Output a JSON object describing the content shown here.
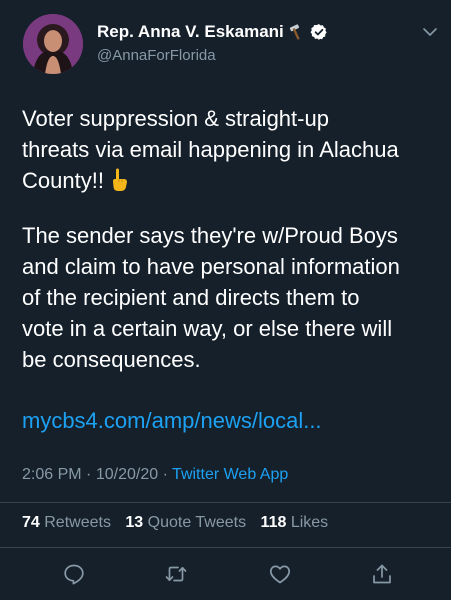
{
  "author": {
    "display_name": "Rep. Anna V. Eskamani",
    "handle": "@AnnaForFlorida",
    "name_emoji_icon": "hammer-icon",
    "verified_icon": "verified-badge-icon"
  },
  "tweet": {
    "paragraph1_line1": "Voter suppression & straight-up",
    "paragraph1_line2": "threats via email happening in Alachua",
    "paragraph1_line3": "County!!",
    "paragraph1_emoji_icon": "pointing-down-hand-icon",
    "paragraph2_line1": "The sender says they're w/Proud Boys",
    "paragraph2_line2": "and claim to have personal information",
    "paragraph2_line3": "of the recipient and directs them to",
    "paragraph2_line4": "vote in a certain way, or else there will",
    "paragraph2_line5": "be consequences.",
    "link_text": "mycbs4.com/amp/news/local..."
  },
  "meta": {
    "time": "2:06 PM",
    "separator": "·",
    "date": "10/20/20",
    "source": "Twitter Web App"
  },
  "stats": {
    "retweets_count": "74",
    "retweets_label": "Retweets",
    "quotes_count": "13",
    "quotes_label": "Quote Tweets",
    "likes_count": "118",
    "likes_label": "Likes"
  },
  "actions": [
    "reply-icon",
    "retweet-icon",
    "like-icon",
    "share-icon"
  ],
  "colors": {
    "background": "#15202b",
    "text": "#ffffff",
    "secondary": "#8899a6",
    "link": "#1da1f2",
    "divider": "#38444d"
  }
}
